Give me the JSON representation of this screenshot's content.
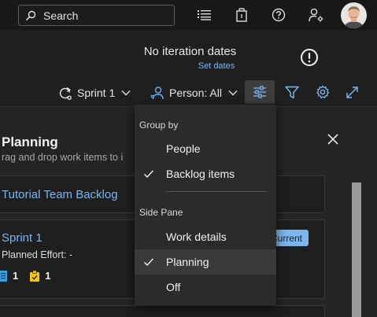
{
  "topbar": {
    "search_label": "Search",
    "icons": [
      "search-icon",
      "list-settings-icon",
      "marketplace-bag-icon",
      "help-icon",
      "user-settings-icon"
    ]
  },
  "iteration": {
    "title": "No iteration dates",
    "set_dates_link": "Set dates",
    "info_icon": "exclamation-circle-icon"
  },
  "toolbar": {
    "sprint_label": "Sprint 1",
    "person_label": "Person: All",
    "icons": [
      "sprint-cycle-icon",
      "person-icon",
      "view-options-icon",
      "filter-icon",
      "gear-icon",
      "expand-icon"
    ]
  },
  "planning": {
    "title": "Planning",
    "subtitle": "rag and drop work items to i",
    "backlog_link": "Tutorial Team Backlog",
    "sprint_link": "Sprint 1",
    "current_badge": "Current",
    "planned_effort": "Planned Effort: -",
    "count_backlog": "1",
    "count_tasks": "1"
  },
  "menu": {
    "group_by_header": "Group by",
    "side_pane_header": "Side Pane",
    "items": [
      {
        "label": "People",
        "checked": false
      },
      {
        "label": "Backlog items",
        "checked": true
      },
      {
        "label": "Work details",
        "checked": false
      },
      {
        "label": "Planning",
        "checked": true
      },
      {
        "label": "Off",
        "checked": false
      }
    ]
  },
  "colors": {
    "accent": "#74b9f5",
    "badge": "#7cb7ec",
    "background": "#1f1f1f",
    "menu_bg": "#2b2b2b"
  }
}
